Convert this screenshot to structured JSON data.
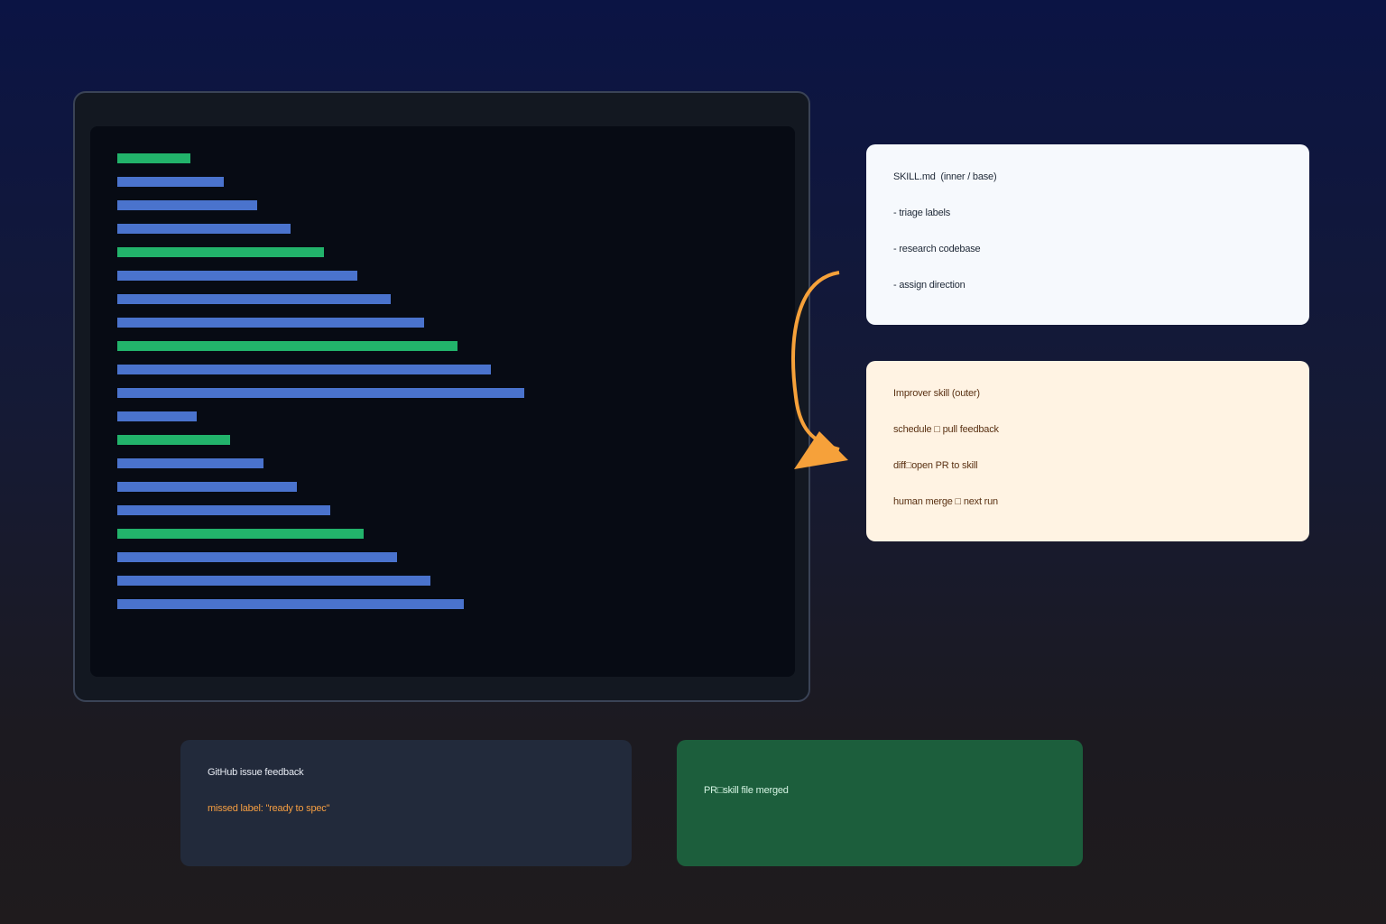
{
  "colors": {
    "accent_orange": "#f6a13a",
    "bar_blue": "#4a73cd",
    "bar_green": "#22b36b",
    "skill_card_bg": "#f6f9fd",
    "improver_card_bg": "#fff3e3",
    "issue_card_bg": "#222a3b",
    "pr_card_bg": "#1c5e3c"
  },
  "skill_card": {
    "title": "SKILL.md  (inner / base)",
    "items": [
      "- triage labels",
      "- research codebase",
      "- assign direction"
    ]
  },
  "improver_card": {
    "title": "Improver skill (outer)",
    "items": [
      "schedule □ pull feedback",
      "diff□open PR to skill",
      "human merge □ next run"
    ]
  },
  "issue_card": {
    "title": "GitHub issue feedback",
    "detail": "missed label: \"ready to spec\""
  },
  "pr_card": {
    "title": "PR□skill file merged"
  },
  "loop_arrow": {
    "from": "skill_card",
    "to": "improver_card",
    "icon": "curved-arrow-icon"
  }
}
